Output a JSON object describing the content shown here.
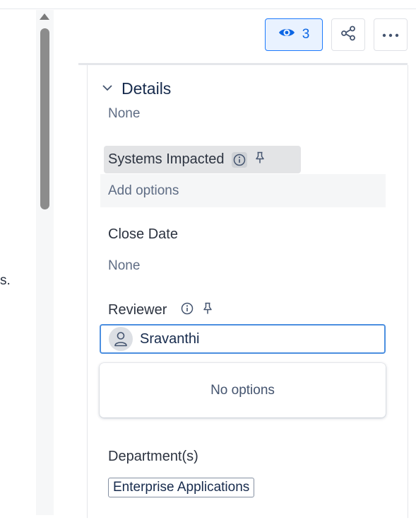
{
  "left_fragment_text": "s.",
  "header": {
    "watch_count": "3",
    "icons": {
      "watch": "eye-icon",
      "share": "share-icon",
      "more": "more-horizontal-icon"
    }
  },
  "details": {
    "title": "Details",
    "partial_value": "None",
    "fields": {
      "systems_impacted": {
        "label": "Systems Impacted",
        "placeholder": "Add options"
      },
      "close_date": {
        "label": "Close Date",
        "value": "None"
      },
      "reviewer": {
        "label": "Reviewer",
        "value": "Sravanthi",
        "dropdown_message": "No options"
      },
      "departments": {
        "label": "Department(s)",
        "tags": [
          "Enterprise Applications"
        ]
      }
    }
  },
  "colors": {
    "accent": "#1d7afc",
    "watch_bg": "#e9f2ff",
    "focus_border": "#4c8fe0",
    "label_highlight": "#e3e4e6"
  }
}
